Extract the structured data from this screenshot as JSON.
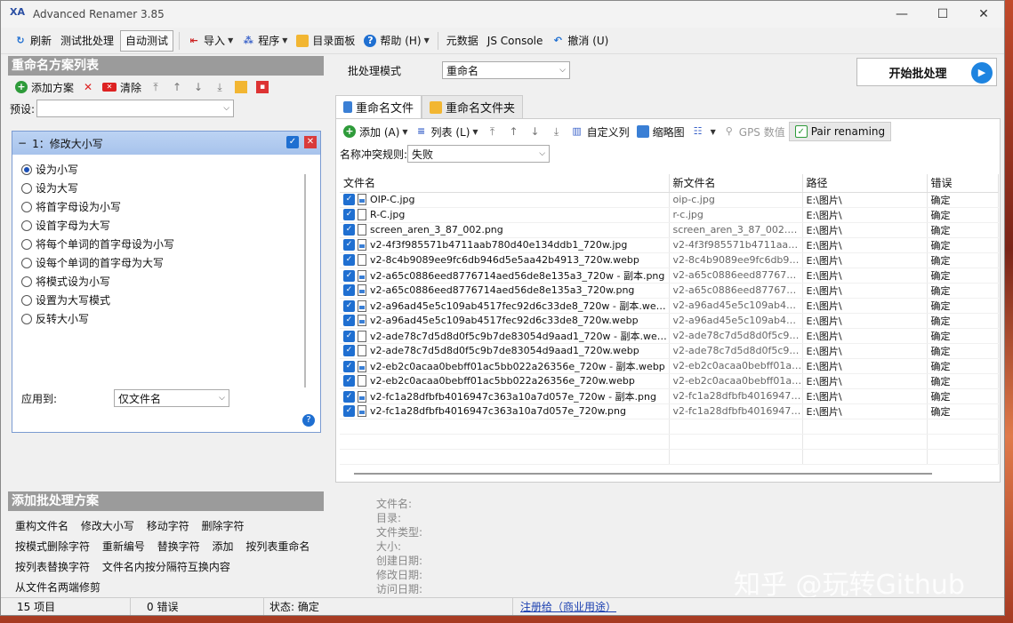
{
  "window": {
    "title": "Advanced Renamer 3.85"
  },
  "toolbar": {
    "refresh": "刷新",
    "test_batch": "测试批处理",
    "auto_test": "自动测试",
    "import": "导入",
    "program": "程序",
    "dir_panel": "目录面板",
    "help": "帮助 (H)",
    "metadata": "元数据",
    "js_console": "JS Console",
    "undo": "撤消 (U)"
  },
  "left": {
    "method_list_title": "重命名方案列表",
    "add_method": "添加方案",
    "clear": "清除",
    "preset_label": "预设:",
    "method_title": "1：修改大小写",
    "options": [
      "设为小写",
      "设为大写",
      "将首字母设为小写",
      "设首字母为大写",
      "将每个单词的首字母设为小写",
      "设每个单词的首字母为大写",
      "将模式设为小写",
      "设置为大写模式",
      "反转大小写"
    ],
    "apply_to_label": "应用到:",
    "apply_to_value": "仅文件名",
    "add_batch_title": "添加批处理方案",
    "batch_methods": [
      "重构文件名",
      "修改大小写",
      "移动字符",
      "删除字符",
      "按模式删除字符",
      "重新编号",
      "替换字符",
      "添加",
      "按列表重命名",
      "按列表替换字符",
      "文件名内按分隔符互换内容",
      "从文件名两端修剪"
    ]
  },
  "right": {
    "mode_label": "批处理模式",
    "mode_value": "重命名",
    "start_button": "开始批处理",
    "tab_files": "重命名文件",
    "tab_folders": "重命名文件夹",
    "files_toolbar": {
      "add": "添加 (A)",
      "list": "列表 (L)",
      "custom_columns": "自定义列",
      "thumbnails": "缩略图",
      "gps": "GPS 数值",
      "pair": "Pair renaming"
    },
    "conflict_label": "名称冲突规则:",
    "conflict_value": "失败",
    "columns": [
      "文件名",
      "新文件名",
      "路径",
      "错误"
    ],
    "rows": [
      {
        "name": "OIP-C.jpg",
        "new": "oip-c.jpg",
        "path": "E:\\图片\\",
        "err": "确定",
        "img": true
      },
      {
        "name": "R-C.jpg",
        "new": "r-c.jpg",
        "path": "E:\\图片\\",
        "err": "确定",
        "img": false
      },
      {
        "name": "screen_aren_3_87_002.png",
        "new": "screen_aren_3_87_002.png",
        "path": "E:\\图片\\",
        "err": "确定",
        "img": false
      },
      {
        "name": "v2-4f3f985571b4711aab780d40e134ddb1_720w.jpg",
        "new": "v2-4f3f985571b4711aab...",
        "path": "E:\\图片\\",
        "err": "确定",
        "img": true
      },
      {
        "name": "v2-8c4b9089ee9fc6db946d5e5aa42b4913_720w.webp",
        "new": "v2-8c4b9089ee9fc6db94...",
        "path": "E:\\图片\\",
        "err": "确定",
        "img": false
      },
      {
        "name": "v2-a65c0886eed8776714aed56de8e135a3_720w - 副本.png",
        "new": "v2-a65c0886eed8776714...",
        "path": "E:\\图片\\",
        "err": "确定",
        "img": true
      },
      {
        "name": "v2-a65c0886eed8776714aed56de8e135a3_720w.png",
        "new": "v2-a65c0886eed8776714...",
        "path": "E:\\图片\\",
        "err": "确定",
        "img": true
      },
      {
        "name": "v2-a96ad45e5c109ab4517fec92d6c33de8_720w - 副本.webp",
        "new": "v2-a96ad45e5c109ab451...",
        "path": "E:\\图片\\",
        "err": "确定",
        "img": true
      },
      {
        "name": "v2-a96ad45e5c109ab4517fec92d6c33de8_720w.webp",
        "new": "v2-a96ad45e5c109ab451...",
        "path": "E:\\图片\\",
        "err": "确定",
        "img": true
      },
      {
        "name": "v2-ade78c7d5d8d0f5c9b7de83054d9aad1_720w - 副本.webp",
        "new": "v2-ade78c7d5d8d0f5c9b...",
        "path": "E:\\图片\\",
        "err": "确定",
        "img": false
      },
      {
        "name": "v2-ade78c7d5d8d0f5c9b7de83054d9aad1_720w.webp",
        "new": "v2-ade78c7d5d8d0f5c9b...",
        "path": "E:\\图片\\",
        "err": "确定",
        "img": false
      },
      {
        "name": "v2-eb2c0acaa0bebff01ac5bb022a26356e_720w - 副本.webp",
        "new": "v2-eb2c0acaa0bebff01ac...",
        "path": "E:\\图片\\",
        "err": "确定",
        "img": true
      },
      {
        "name": "v2-eb2c0acaa0bebff01ac5bb022a26356e_720w.webp",
        "new": "v2-eb2c0acaa0bebff01ac...",
        "path": "E:\\图片\\",
        "err": "确定",
        "img": false
      },
      {
        "name": "v2-fc1a28dfbfb4016947c363a10a7d057e_720w - 副本.png",
        "new": "v2-fc1a28dfbfb4016947c...",
        "path": "E:\\图片\\",
        "err": "确定",
        "img": true
      },
      {
        "name": "v2-fc1a28dfbfb4016947c363a10a7d057e_720w.png",
        "new": "v2-fc1a28dfbfb4016947c...",
        "path": "E:\\图片\\",
        "err": "确定",
        "img": true
      }
    ],
    "info_labels": [
      "文件名:",
      "目录:",
      "文件类型:",
      "大小:",
      "创建日期:",
      "修改日期:",
      "访问日期:"
    ]
  },
  "watermark": "知乎 @玩转Github",
  "status": {
    "items": "15 项目",
    "errors": "0 错误",
    "state": "状态: 确定",
    "license": "注册给（商业用途）"
  },
  "colors": {
    "accent": "#1f6fd1",
    "panel_header": "#9b9b9b"
  }
}
